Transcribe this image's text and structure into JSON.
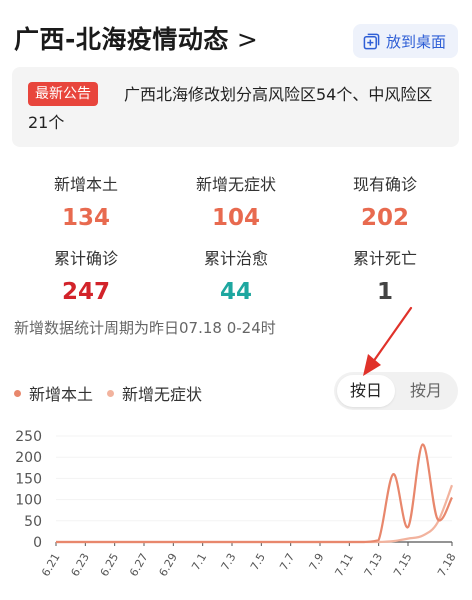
{
  "header": {
    "title": "广西-北海疫情动态",
    "chevron": ">",
    "add_desktop_label": "放到桌面"
  },
  "notice": {
    "badge": "最新公告",
    "text": "广西北海修改划分高风险区54个、中风险区21个"
  },
  "stats": [
    {
      "label": "新增本土",
      "value": "134",
      "color": "#e86a4f"
    },
    {
      "label": "新增无症状",
      "value": "104",
      "color": "#e86a4f"
    },
    {
      "label": "现有确诊",
      "value": "202",
      "color": "#e86a4f"
    },
    {
      "label": "累计确诊",
      "value": "247",
      "color": "#d2232a"
    },
    {
      "label": "累计治愈",
      "value": "44",
      "color": "#1ea7a0"
    },
    {
      "label": "累计死亡",
      "value": "1",
      "color": "#444444"
    }
  ],
  "period_note": "新增数据统计周期为昨日07.18 0-24时",
  "legend": [
    {
      "name": "新增本土",
      "color": "#e8876c"
    },
    {
      "name": "新增无症状",
      "color": "#f2b39e"
    }
  ],
  "toggle": {
    "options": [
      "按日",
      "按月"
    ],
    "selected": "按日"
  },
  "colors": {
    "accent": "#2f5fd6",
    "badge": "#e8453c",
    "arrow": "#e0322a"
  },
  "chart_data": {
    "type": "line",
    "x": [
      "6.21",
      "6.22",
      "6.23",
      "6.24",
      "6.25",
      "6.26",
      "6.27",
      "6.28",
      "6.29",
      "6.30",
      "7.1",
      "7.2",
      "7.3",
      "7.4",
      "7.5",
      "7.6",
      "7.7",
      "7.8",
      "7.9",
      "7.10",
      "7.11",
      "7.12",
      "7.13",
      "7.14",
      "7.15",
      "7.16",
      "7.17",
      "7.18"
    ],
    "x_tick_labels": [
      "6.21",
      "6.23",
      "6.25",
      "6.27",
      "6.29",
      "7.1",
      "7.3",
      "7.5",
      "7.7",
      "7.9",
      "7.11",
      "7.13",
      "7.15",
      "7.18"
    ],
    "y_ticks": [
      "0",
      "50",
      "100",
      "150",
      "200",
      "250"
    ],
    "ylim": [
      0,
      250
    ],
    "series": [
      {
        "name": "新增本土",
        "color": "#e8876c",
        "values": [
          0,
          0,
          0,
          0,
          0,
          0,
          0,
          0,
          0,
          0,
          0,
          0,
          0,
          0,
          0,
          0,
          0,
          0,
          0,
          0,
          0,
          0,
          5,
          160,
          35,
          230,
          55,
          105
        ]
      },
      {
        "name": "新增无症状",
        "color": "#f2b39e",
        "values": [
          0,
          0,
          0,
          0,
          0,
          0,
          0,
          0,
          0,
          0,
          0,
          0,
          0,
          0,
          0,
          0,
          0,
          0,
          0,
          0,
          0,
          0,
          0,
          2,
          8,
          15,
          45,
          134
        ]
      }
    ]
  }
}
